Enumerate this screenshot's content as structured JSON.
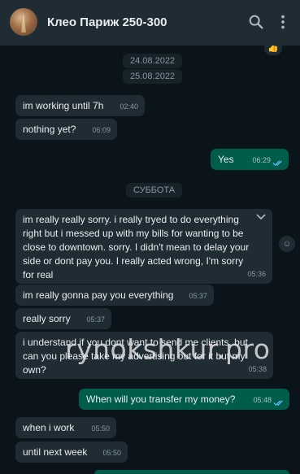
{
  "header": {
    "title": "Клео Париж 250-300"
  },
  "reaction": {
    "emoji": "👍"
  },
  "dates": [
    "24.08.2022",
    "25.08.2022",
    "СУББОТА"
  ],
  "messages": [
    {
      "text": "im working until 7h",
      "time": "02:40"
    },
    {
      "text": "nothing yet?",
      "time": "06:09"
    },
    {
      "text": "Yes",
      "time": "06:29"
    },
    {
      "text": "im really really sorry. i really tryed to do everything right but i messed up with my bills for wanting to be close to downtown. sorry.  I didn't mean to delay your side or dont pay you. I really acted wrong, I'm sorry for real",
      "time": "05:36"
    },
    {
      "text": "im really gonna pay you everything",
      "time": "05:37"
    },
    {
      "text": "really sorry",
      "time": "05:37"
    },
    {
      "text": "i understand if you dont want to send me clients. but can you please take my advertising out for it but my own?",
      "time": "05:38"
    },
    {
      "text": "When will you transfer my money?",
      "time": "05:48"
    },
    {
      "text": "when i work",
      "time": "05:50"
    },
    {
      "text": "until next week",
      "time": "05:50"
    }
  ],
  "watermark": "rynokshkur.pro",
  "colors": {
    "incoming": "#202c33",
    "outgoing": "#005c4b",
    "background": "#0b141a",
    "read_ticks": "#53bdeb"
  },
  "icons": [
    "back-avatar",
    "search-icon",
    "more-vert-icon",
    "chevron-down-icon",
    "emoji-icon",
    "double-check-icon"
  ]
}
